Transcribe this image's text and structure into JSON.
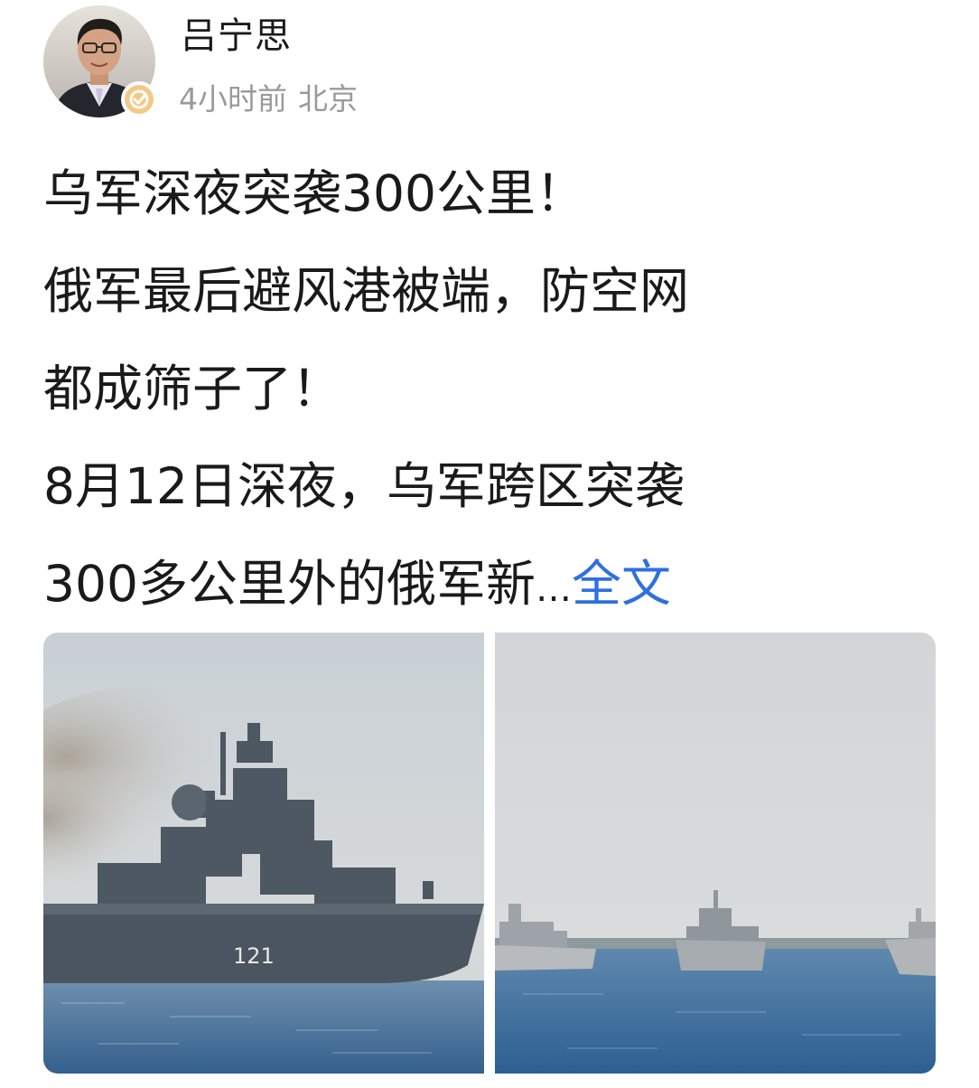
{
  "author": {
    "name": "吕宁思",
    "avatar_icon": "person-portrait",
    "verified_icon": "verified-badge-icon",
    "time": "4小时前",
    "location": "北京"
  },
  "post": {
    "lines": [
      "乌军深夜突袭300公里！",
      "俄军最后避风港被端，防空网",
      "都成筛子了！",
      "8月12日深夜，乌军跨区突袭",
      "300多公里外的俄军新"
    ],
    "ellipsis": "…",
    "full_text_link": "全文",
    "link_color": "#2f6fe0"
  },
  "images": [
    {
      "name": "warship-photo-left",
      "hull_number": "121"
    },
    {
      "name": "warships-photo-right"
    }
  ]
}
